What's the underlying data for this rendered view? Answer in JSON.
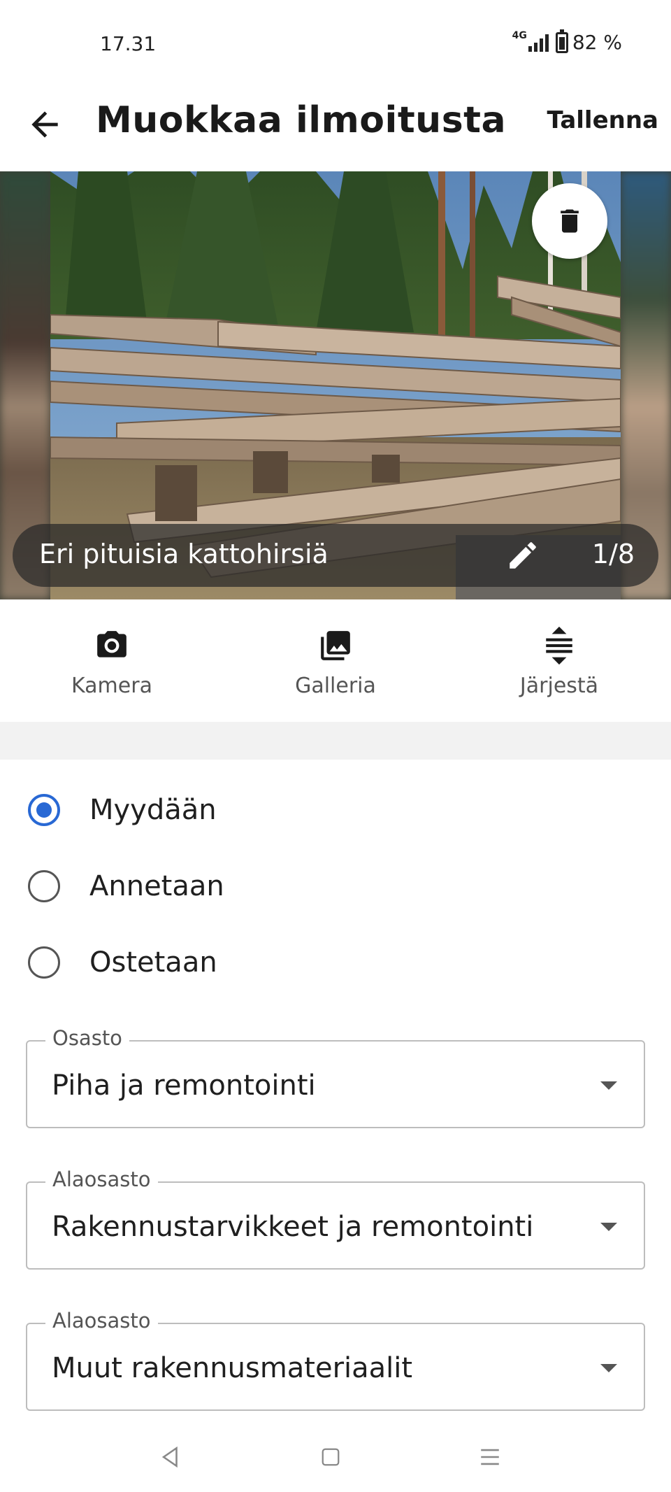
{
  "status_bar": {
    "time": "17.31",
    "network": "4G",
    "battery": "82 %"
  },
  "app_bar": {
    "title": "Muokkaa ilmoitusta",
    "save_label": "Tallenna"
  },
  "carousel": {
    "caption": "Eri pituisia kattohirsiä",
    "counter": "1/8"
  },
  "toolbar": {
    "camera_label": "Kamera",
    "gallery_label": "Galleria",
    "arrange_label": "Järjestä"
  },
  "listing_type": {
    "options": [
      {
        "label": "Myydään",
        "selected": true
      },
      {
        "label": "Annetaan",
        "selected": false
      },
      {
        "label": "Ostetaan",
        "selected": false
      }
    ]
  },
  "fields": [
    {
      "label": "Osasto",
      "value": "Piha ja remontointi"
    },
    {
      "label": "Alaosasto",
      "value": "Rakennustarvikkeet ja remontointi"
    },
    {
      "label": "Alaosasto",
      "value": "Muut rakennusmateriaalit"
    }
  ],
  "colors": {
    "accent": "#2868d4",
    "text": "#1f1f1f",
    "muted": "#555555",
    "border": "#bdbdbd"
  }
}
